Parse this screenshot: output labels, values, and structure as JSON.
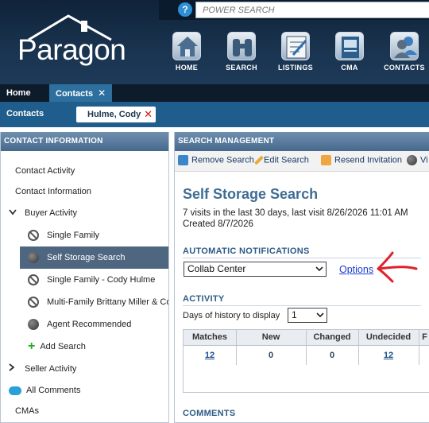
{
  "header": {
    "help_icon": "?",
    "search_placeholder": "POWER SEARCH",
    "logo": "Paragon",
    "nav": [
      {
        "label": "HOME",
        "icon": "house-icon"
      },
      {
        "label": "SEARCH",
        "icon": "binoculars-icon"
      },
      {
        "label": "LISTINGS",
        "icon": "listings-icon"
      },
      {
        "label": "CMA",
        "icon": "cma-icon"
      },
      {
        "label": "CONTACTS",
        "icon": "contacts-icon"
      }
    ]
  },
  "tabs": [
    {
      "label": "Home"
    },
    {
      "label": "Contacts",
      "close": "✕"
    }
  ],
  "subbar": {
    "label": "Contacts",
    "open_contact": "Hulme, Cody",
    "close": "✕"
  },
  "left_panel": {
    "heading": "CONTACT INFORMATION",
    "items": [
      {
        "label": "Contact Activity"
      },
      {
        "label": "Contact Information"
      },
      {
        "label": "Buyer Activity",
        "chevron": "⌄"
      },
      {
        "label": "Single Family"
      },
      {
        "label": "Self Storage Search"
      },
      {
        "label": "Single Family - Cody Hulme"
      },
      {
        "label": "Multi-Family Brittany Miller & Co"
      },
      {
        "label": "Agent Recommended"
      },
      {
        "label": "Add Search",
        "icon": "+"
      },
      {
        "label": "Seller Activity",
        "chevron": "›"
      },
      {
        "label": "All Comments"
      },
      {
        "label": "CMAs"
      }
    ]
  },
  "right_panel": {
    "heading": "SEARCH MANAGEMENT",
    "toolbar": [
      {
        "label": "Remove Search",
        "icon": "trash-icon"
      },
      {
        "label": "Edit Search",
        "icon": "pencil-icon"
      },
      {
        "label": "Resend Invitation",
        "icon": "envelope-icon"
      },
      {
        "label": "Vi",
        "icon": "globe-icon"
      }
    ],
    "title": "Self Storage Search",
    "visits": "7 visits in the last 30 days, last visit 8/26/2026 11:01 AM",
    "created": "Created 8/7/2026",
    "auto_notifications_label": "AUTOMATIC NOTIFICATIONS",
    "notification_value": "Collab Center",
    "options_link": "Options",
    "activity_label": "ACTIVITY",
    "days_label": "Days of history to display",
    "days_value": "1",
    "grid": {
      "headers": [
        "Matches",
        "New",
        "Changed",
        "Undecided",
        "F"
      ],
      "values": [
        "12",
        "0",
        "0",
        "12",
        ""
      ]
    },
    "comments_label": "COMMENTS"
  },
  "colors": {
    "header_bg": "#1a3450",
    "subbar_bg": "#1f5e8c",
    "selected_row": "#4e6680",
    "title_blue": "#3f6c95",
    "link_blue": "#1b3bd6",
    "annotation_red": "#e0202a"
  }
}
